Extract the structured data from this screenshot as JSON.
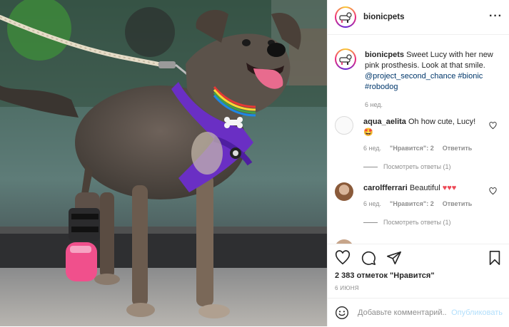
{
  "post": {
    "username": "bionicpets",
    "more_icon": "more-horizontal-icon"
  },
  "caption": {
    "username": "bionicpets",
    "text": "Sweet Lucy with her new pink prosthesis. Look at that smile.",
    "mention": "@project_second_chance",
    "tag1": "#bionic",
    "tag2": "#robodog",
    "age": "6 нед."
  },
  "comments": [
    {
      "username": "aqua_aelita",
      "text": "Oh how cute, Lucy!",
      "emoji": "🤩",
      "age": "6 нед.",
      "likes": "\"Нравится\": 2",
      "reply": "Ответить",
      "view_replies": "Посмотреть ответы (1)"
    },
    {
      "username": "carolfferrari",
      "text": "Beautiful",
      "hearts": "♥♥♥",
      "age": "6 нед.",
      "likes": "\"Нравится\": 2",
      "reply": "Ответить",
      "view_replies": "Посмотреть ответы (1)"
    }
  ],
  "actions": {
    "like_icon": "heart-icon",
    "comment_icon": "comment-icon",
    "share_icon": "share-icon",
    "save_icon": "bookmark-icon",
    "likes": "2 383 отметок \"Нравится\"",
    "date": "6 ИЮНЯ"
  },
  "add_comment": {
    "placeholder": "Добавьте комментарий...",
    "post_label": "Опубликовать",
    "emoji_icon": "smiley-icon"
  },
  "colors": {
    "link": "#00376b",
    "meta": "#8e8e8e",
    "post_disabled": "#b2dffc",
    "heart_red": "#ed4956",
    "harness": "#6a2fc4",
    "prosthesis": "#f0508c"
  }
}
